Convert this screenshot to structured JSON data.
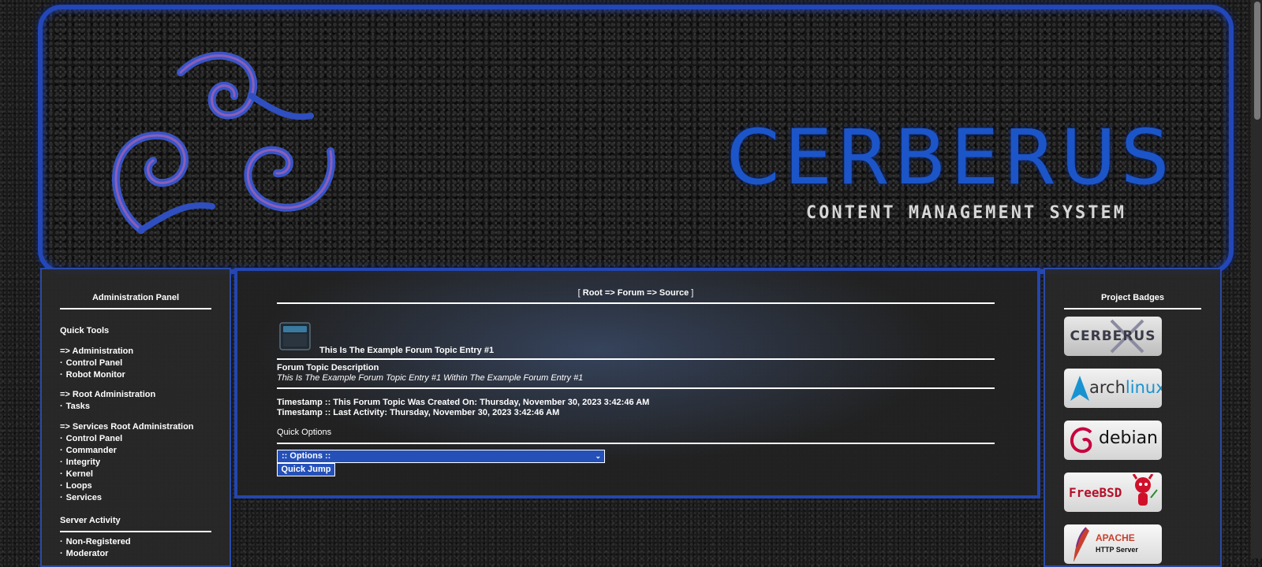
{
  "banner": {
    "title": "CERBERUS",
    "subtitle": "CONTENT MANAGEMENT SYSTEM"
  },
  "left_panel": {
    "title": "Administration Panel",
    "quick_tools": "Quick Tools",
    "groups": [
      {
        "label": "=> Administration",
        "items": [
          "Control Panel",
          "Robot Monitor"
        ]
      },
      {
        "label": "=> Root Administration",
        "items": [
          "Tasks"
        ]
      },
      {
        "label": "=> Services Root Administration",
        "items": [
          "Control Panel",
          "Commander",
          "Integrity",
          "Kernel",
          "Loops",
          "Services"
        ]
      }
    ],
    "server_activity": "Server Activity",
    "activity_items": [
      "Non-Registered",
      "Moderator"
    ]
  },
  "center": {
    "breadcrumb": {
      "open": "[",
      "path": "Root => Forum => Source",
      "close": "]"
    },
    "topic_title": "This Is The Example Forum Topic Entry #1",
    "description_label": "Forum Topic Description",
    "description_text": "This Is The Example Forum Topic Entry #1 Within The Example Forum Entry #1",
    "created_label": "Timestamp :: This Forum Topic Was Created On",
    "created_value": "Thursday, November 30, 2023 3:42:46 AM",
    "activity_label": "Timestamp :: Last Activity",
    "activity_value": "Thursday, November 30, 2023 3:42:46 AM",
    "quick_options": "Quick Options",
    "select_value": ":: Options ::",
    "quick_jump": "Quick Jump"
  },
  "right_panel": {
    "title": "Project Badges",
    "badges": [
      {
        "name": "Cerberus",
        "text": "CERBERUS"
      },
      {
        "name": "Arch Linux",
        "text_a": "arch",
        "text_b": "linux"
      },
      {
        "name": "Debian",
        "text": "debian"
      },
      {
        "name": "FreeBSD",
        "text": "FreeBSD"
      },
      {
        "name": "Apache",
        "text_a": "APACHE",
        "text_b": "HTTP Server"
      }
    ]
  },
  "colors": {
    "accent_blue": "#2550b8",
    "frame_blue": "#2446b0",
    "text": "#ffffff"
  }
}
